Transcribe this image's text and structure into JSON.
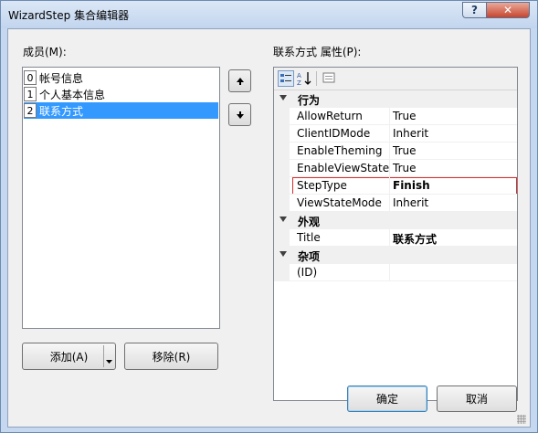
{
  "window": {
    "title": "WizardStep 集合编辑器",
    "help_label": "?",
    "close_label": "✕"
  },
  "members": {
    "label": "成员(M):",
    "items": [
      {
        "index": "0",
        "label": "帐号信息",
        "selected": false
      },
      {
        "index": "1",
        "label": "个人基本信息",
        "selected": false
      },
      {
        "index": "2",
        "label": "联系方式",
        "selected": true
      }
    ]
  },
  "buttons": {
    "add": "添加(A)",
    "remove": "移除(R)",
    "ok": "确定",
    "cancel": "取消"
  },
  "properties": {
    "label": "联系方式 属性(P):",
    "categories": [
      {
        "name": "行为",
        "rows": [
          {
            "name": "AllowReturn",
            "value": "True"
          },
          {
            "name": "ClientIDMode",
            "value": "Inherit"
          },
          {
            "name": "EnableTheming",
            "value": "True"
          },
          {
            "name": "EnableViewState",
            "value": "True"
          },
          {
            "name": "StepType",
            "value": "Finish"
          },
          {
            "name": "ViewStateMode",
            "value": "Inherit"
          }
        ]
      },
      {
        "name": "外观",
        "rows": [
          {
            "name": "Title",
            "value": "联系方式"
          }
        ]
      },
      {
        "name": "杂项",
        "rows": [
          {
            "name": "(ID)",
            "value": ""
          }
        ]
      }
    ]
  },
  "colors": {
    "selection": "#3399ff",
    "highlight_border": "#d62e2e"
  }
}
